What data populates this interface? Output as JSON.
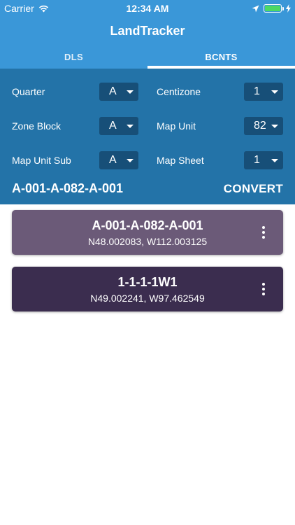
{
  "status": {
    "carrier": "Carrier",
    "time": "12:34 AM"
  },
  "app": {
    "title": "LandTracker"
  },
  "tabs": [
    {
      "label": "DLS",
      "active": false
    },
    {
      "label": "BCNTS",
      "active": true
    }
  ],
  "form": {
    "quarter": {
      "label": "Quarter",
      "value": "A"
    },
    "centizone": {
      "label": "Centizone",
      "value": "1"
    },
    "zone_block": {
      "label": "Zone Block",
      "value": "A"
    },
    "map_unit": {
      "label": "Map Unit",
      "value": "82"
    },
    "map_unit_sub": {
      "label": "Map Unit Sub",
      "value": "A"
    },
    "map_sheet": {
      "label": "Map Sheet",
      "value": "1"
    }
  },
  "result": {
    "code": "A-001-A-082-A-001",
    "convert_label": "CONVERT"
  },
  "history": [
    {
      "title": "A-001-A-082-A-001",
      "coords": "N48.002083, W112.003125",
      "color": "#6b5a78"
    },
    {
      "title": "1-1-1-1W1",
      "coords": "N49.002241, W97.462549",
      "color": "#3b2d4f"
    }
  ],
  "colors": {
    "header": "#3a97d8",
    "panel": "#2373a8",
    "select": "#174f78",
    "battery": "#4cd964"
  }
}
